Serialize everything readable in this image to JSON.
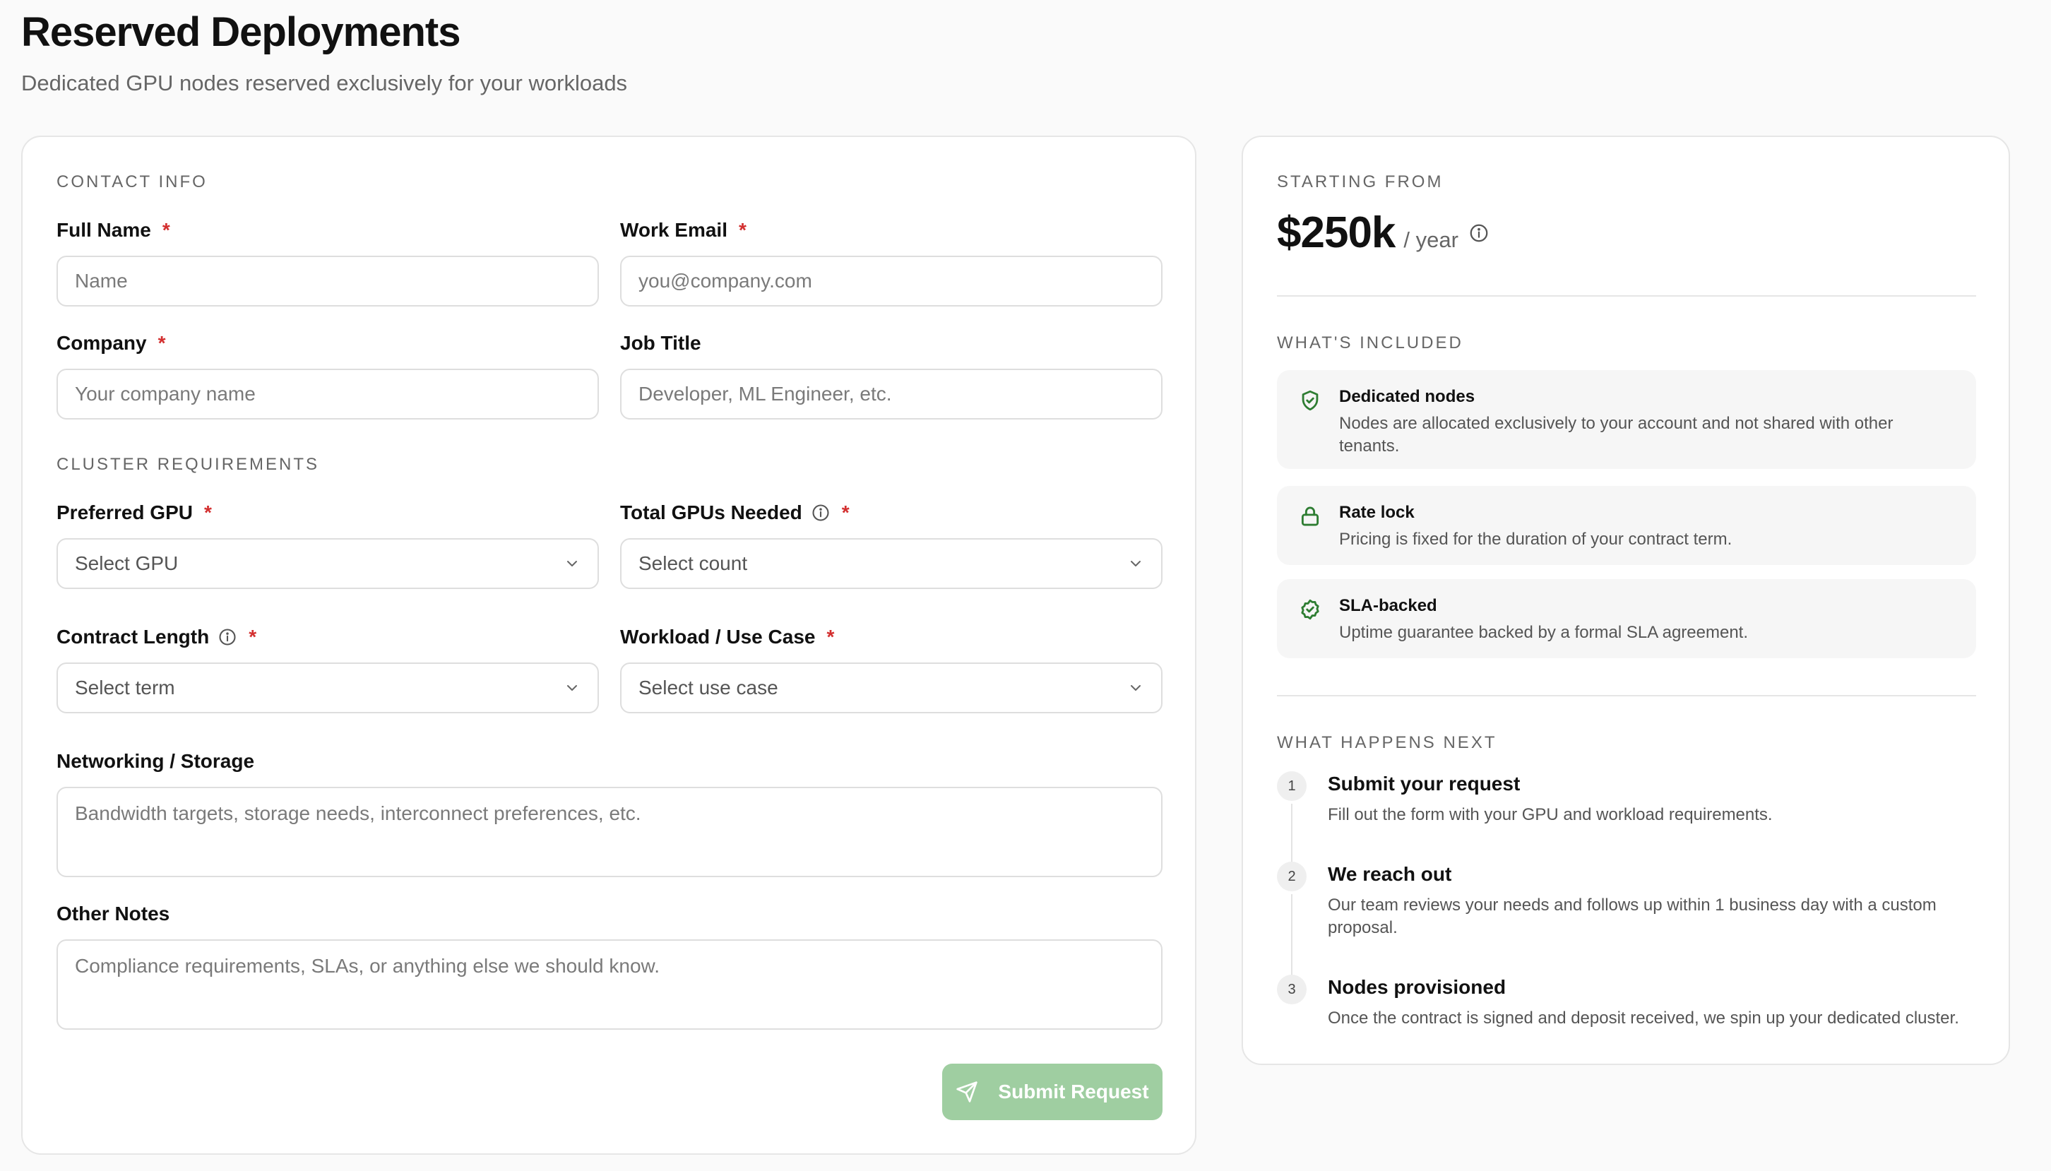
{
  "header": {
    "title": "Reserved Deployments",
    "subtitle": "Dedicated GPU nodes reserved exclusively for your workloads"
  },
  "form": {
    "contact_section": "CONTACT INFO",
    "full_name": {
      "label": "Full Name",
      "placeholder": "Name",
      "required": "*"
    },
    "work_email": {
      "label": "Work Email",
      "placeholder": "you@company.com",
      "required": "*"
    },
    "company": {
      "label": "Company",
      "placeholder": "Your company name",
      "required": "*"
    },
    "job_title": {
      "label": "Job Title",
      "placeholder": "Developer, ML Engineer, etc."
    },
    "cluster_section": "CLUSTER REQUIREMENTS",
    "preferred_gpu": {
      "label": "Preferred GPU",
      "value": "Select GPU",
      "required": "*"
    },
    "total_gpus": {
      "label": "Total GPUs Needed",
      "value": "Select count",
      "required": "*"
    },
    "contract_length": {
      "label": "Contract Length",
      "value": "Select term",
      "required": "*"
    },
    "workload": {
      "label": "Workload / Use Case",
      "value": "Select use case",
      "required": "*"
    },
    "networking": {
      "label": "Networking / Storage",
      "placeholder": "Bandwidth targets, storage needs, interconnect preferences, etc."
    },
    "other_notes": {
      "label": "Other Notes",
      "placeholder": "Compliance requirements, SLAs, or anything else we should know."
    },
    "submit_label": "Submit Request"
  },
  "pricing": {
    "starting_label": "STARTING FROM",
    "price": "$250k",
    "period": "/ year",
    "included_label": "WHAT'S INCLUDED",
    "features": [
      {
        "title": "Dedicated nodes",
        "desc": "Nodes are allocated exclusively to your account and not shared with other tenants.",
        "icon": "shield-check-icon"
      },
      {
        "title": "Rate lock",
        "desc": "Pricing is fixed for the duration of your contract term.",
        "icon": "lock-icon"
      },
      {
        "title": "SLA-backed",
        "desc": "Uptime guarantee backed by a formal SLA agreement.",
        "icon": "check-circle-icon"
      }
    ],
    "next_label": "WHAT HAPPENS NEXT",
    "steps": [
      {
        "num": "1",
        "title": "Submit your request",
        "desc": "Fill out the form with your GPU and workload requirements."
      },
      {
        "num": "2",
        "title": "We reach out",
        "desc": "Our team reviews your needs and follows up within 1 business day with a custom proposal."
      },
      {
        "num": "3",
        "title": "Nodes provisioned",
        "desc": "Once the contract is signed and deposit received, we spin up your dedicated cluster."
      }
    ]
  },
  "colors": {
    "accent": "#9fcea1",
    "icon_green": "#2e7d32",
    "required": "#d32f2f"
  }
}
